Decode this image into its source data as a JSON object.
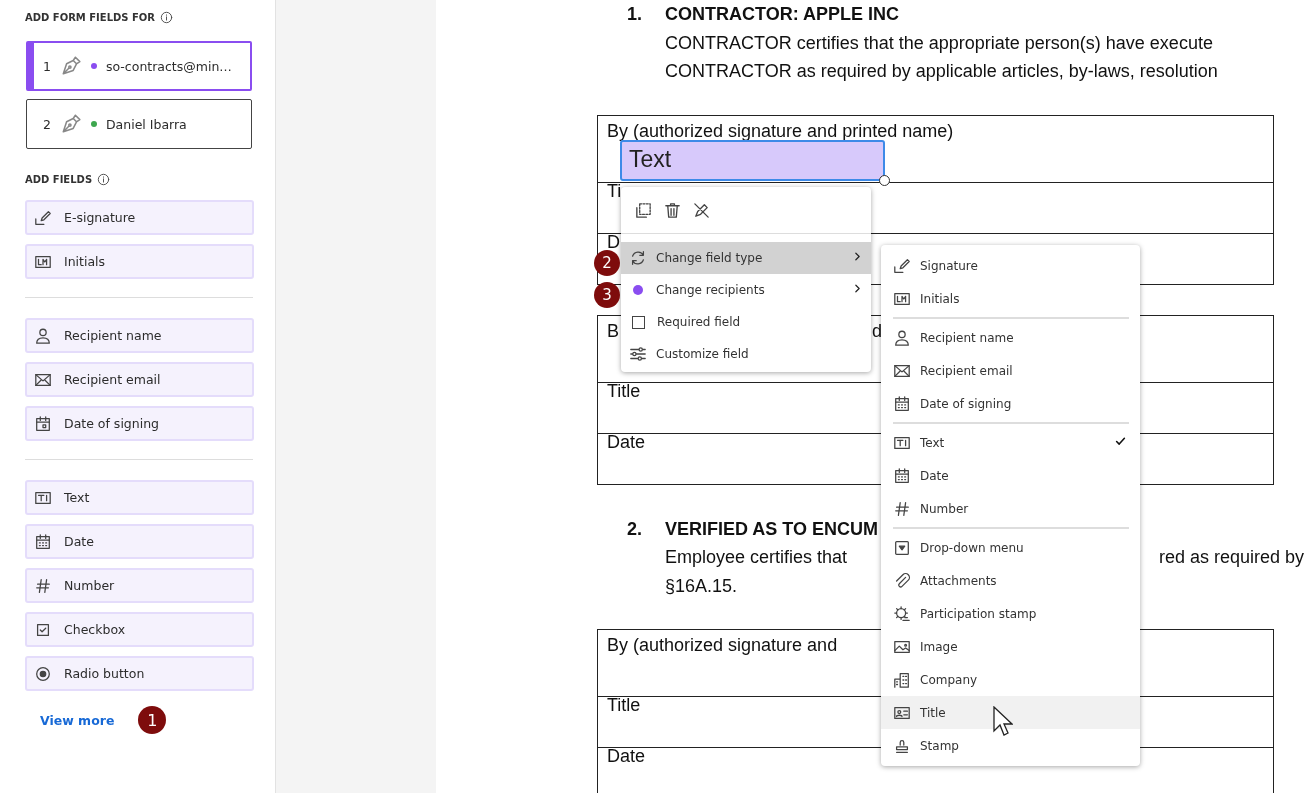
{
  "sidebar": {
    "recipients_heading": "ADD FORM FIELDS FOR",
    "recipients": [
      {
        "number": "1",
        "name": "so-contracts@min…",
        "color": "#8a4df0",
        "selected": true
      },
      {
        "number": "2",
        "name": "Daniel Ibarra",
        "color": "#3da74e",
        "selected": false
      }
    ],
    "fields_heading": "ADD FIELDS",
    "field_groups": [
      [
        {
          "label": "E-signature",
          "kind": "signature"
        },
        {
          "label": "Initials",
          "kind": "initials"
        }
      ],
      [
        {
          "label": "Recipient name",
          "kind": "person"
        },
        {
          "label": "Recipient email",
          "kind": "email"
        },
        {
          "label": "Date of signing",
          "kind": "signdate"
        }
      ],
      [
        {
          "label": "Text",
          "kind": "text"
        },
        {
          "label": "Date",
          "kind": "date"
        },
        {
          "label": "Number",
          "kind": "number"
        },
        {
          "label": "Checkbox",
          "kind": "checkbox"
        },
        {
          "label": "Radio button",
          "kind": "radio"
        }
      ]
    ],
    "view_more": "View more",
    "view_more_badge": "1"
  },
  "document": {
    "sections": [
      {
        "number": "1.",
        "heading": "CONTRACTOR: APPLE INC",
        "lines": [
          [
            "CONTRACTOR certifies that the appropriate person(s) have execute"
          ],
          [
            "CONTRACTOR as required by applicable articles, by-laws, resolution"
          ]
        ],
        "tables": [
          [
            [
              "By  (authorized signature and printed name)"
            ],
            [
              "Ti"
            ],
            [
              "D"
            ]
          ],
          [
            [
              "B",
              "d"
            ],
            [
              "Title"
            ],
            [
              "Date"
            ]
          ]
        ]
      },
      {
        "number": "2.",
        "heading": "VERIFIED AS TO ENCUM",
        "lines": [
          [
            "Employee certifies that",
            "red as required by"
          ],
          [
            "§16A.15."
          ]
        ],
        "tables": [
          [
            [
              "By  (authorized signature and"
            ],
            [
              "Title"
            ],
            [
              "Date"
            ]
          ]
        ]
      }
    ]
  },
  "text_field": {
    "label": "Text"
  },
  "context_menu": {
    "items": [
      {
        "label": "Change field type",
        "kind": "refresh",
        "highlighted": true,
        "submenu": true,
        "badge": "2"
      },
      {
        "label": "Change recipients",
        "kind": "dot",
        "color": "#8a4df0",
        "highlighted": false,
        "submenu": true,
        "badge": "3"
      },
      {
        "label": "Required field",
        "kind": "checkbox",
        "checked": false,
        "highlighted": false,
        "submenu": false
      },
      {
        "label": "Customize field",
        "kind": "sliders",
        "highlighted": false,
        "submenu": false
      }
    ]
  },
  "type_menu": {
    "groups": [
      [
        {
          "label": "Signature",
          "kind": "signature",
          "checked": false,
          "highlighted": false
        },
        {
          "label": "Initials",
          "kind": "initials",
          "checked": false,
          "highlighted": false
        }
      ],
      [
        {
          "label": "Recipient name",
          "kind": "person",
          "checked": false,
          "highlighted": false
        },
        {
          "label": "Recipient email",
          "kind": "email",
          "checked": false,
          "highlighted": false
        },
        {
          "label": "Date of signing",
          "kind": "date",
          "checked": false,
          "highlighted": false
        }
      ],
      [
        {
          "label": "Text",
          "kind": "text",
          "checked": true,
          "highlighted": false
        },
        {
          "label": "Date",
          "kind": "date",
          "checked": false,
          "highlighted": false
        },
        {
          "label": "Number",
          "kind": "number",
          "checked": false,
          "highlighted": false
        }
      ],
      [
        {
          "label": "Drop-down menu",
          "kind": "dropdown",
          "checked": false,
          "highlighted": false
        },
        {
          "label": "Attachments",
          "kind": "attachment",
          "checked": false,
          "highlighted": false
        },
        {
          "label": "Participation stamp",
          "kind": "gearstamp",
          "checked": false,
          "highlighted": false
        },
        {
          "label": "Image",
          "kind": "image",
          "checked": false,
          "highlighted": false
        },
        {
          "label": "Company",
          "kind": "company",
          "checked": false,
          "highlighted": false
        },
        {
          "label": "Title",
          "kind": "title",
          "checked": false,
          "highlighted": true
        },
        {
          "label": "Stamp",
          "kind": "stamp",
          "checked": false,
          "highlighted": false
        }
      ]
    ]
  }
}
